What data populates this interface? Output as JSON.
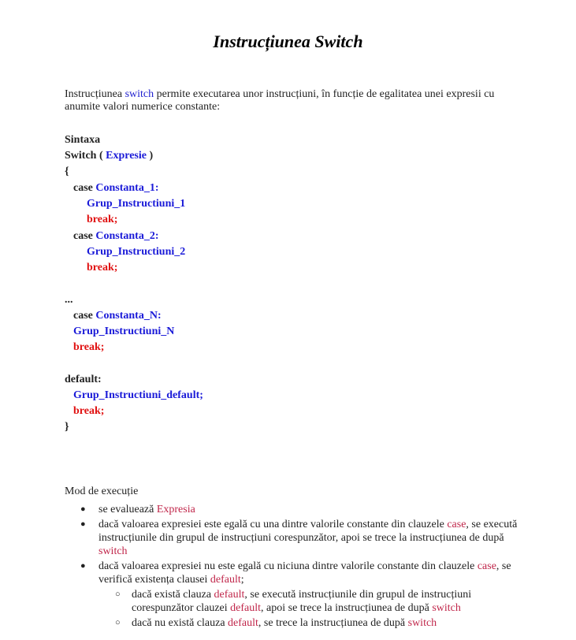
{
  "title": "Instrucțiunea Switch",
  "intro": {
    "pre": "Instrucțiunea ",
    "keyword": "switch",
    "post": " permite executarea unor instrucțiuni, în funcție de egalitatea unei expresii cu anumite valori numerice constante:"
  },
  "syntax": {
    "heading": "Sintaxa",
    "switch_kw": "Switch ( ",
    "switch_expr": "Expresie",
    "switch_close": " )",
    "open_brace": "{",
    "case_kw": "case ",
    "const1": "Constanta_1:",
    "group1": "Grup_Instructiuni_1",
    "break": "break;",
    "const2": "Constanta_2:",
    "group2": "Grup_Instructiuni_2",
    "ellipsis": "...",
    "constN": "Constanta_N:",
    "groupN": "Grup_Instructiuni_N",
    "default_kw": "default:",
    "group_default": "Grup_Instructiuni_default;",
    "close_brace": "}"
  },
  "execution": {
    "heading": "Mod de execuție",
    "b1_pre": "se evaluează ",
    "b1_kw": "Expresia",
    "b2_pre": "dacă valoarea expresiei este egală cu una dintre valorile constante din clauzele ",
    "b2_kw1": "case",
    "b2_mid": ", se execută instrucțiunile din grupul de instrucțiuni corespunzător, apoi se trece la instrucțiunea de după ",
    "b2_kw2": "switch",
    "b3_pre": "dacă valoarea expresiei nu este egală cu niciuna dintre valorile constante din clauzele ",
    "b3_kw1": "case",
    "b3_mid": ", se verifică existența clausei ",
    "b3_kw2": "default",
    "b3_end": ";",
    "s1_pre": "dacă există clauza ",
    "s1_kw1": "default",
    "s1_mid": ", se execută instrucțiunile din grupul de instrucțiuni corespunzător clauzei ",
    "s1_kw2": "default",
    "s1_mid2": ", apoi se trece la instrucțiunea de după ",
    "s1_kw3": "switch",
    "s2_pre": "dacă nu există clauza ",
    "s2_kw1": "default",
    "s2_mid": ", se trece la instrucțiunea de după ",
    "s2_kw2": "switch"
  }
}
